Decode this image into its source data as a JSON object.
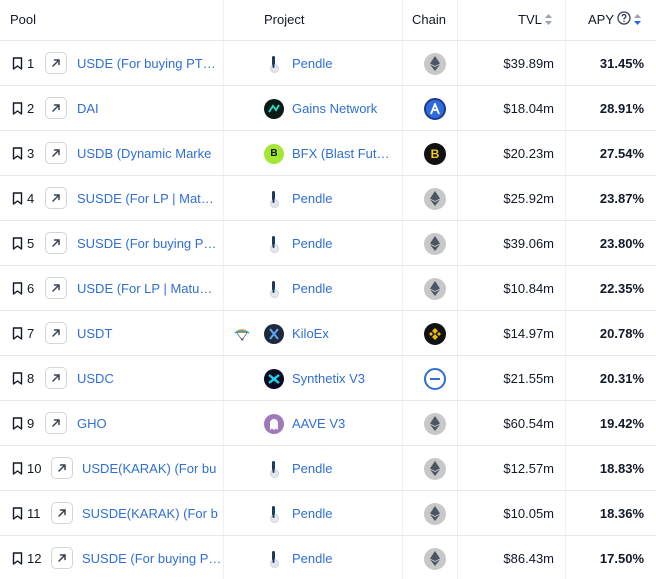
{
  "header": {
    "pool": "Pool",
    "project": "Project",
    "chain": "Chain",
    "tvl": "TVL",
    "apy": "APY"
  },
  "colors": {
    "link": "#2f6fd6",
    "sort_active": "#2563eb",
    "ethereum": "#c7c7c7",
    "arbitrum": "#2d6bdf",
    "blast": "#111111",
    "bsc": "#111111",
    "optimism_like": "#2f6fd6"
  },
  "rows": [
    {
      "rank": "1",
      "pool": "USDE (For buying PT…",
      "project": "Pendle",
      "project_icon": "pendle-icon",
      "chain_icon": "ethereum-icon",
      "tvl": "$39.89m",
      "apy": "31.45%"
    },
    {
      "rank": "2",
      "pool": "DAI",
      "project": "Gains Network",
      "project_icon": "gains-network-icon",
      "chain_icon": "arbitrum-icon",
      "tvl": "$18.04m",
      "apy": "28.91%"
    },
    {
      "rank": "3",
      "pool": "USDB (Dynamic Marke",
      "project": "BFX (Blast Fut…",
      "project_icon": "bfx-icon",
      "chain_icon": "blast-icon",
      "tvl": "$20.23m",
      "apy": "27.54%"
    },
    {
      "rank": "4",
      "pool": "SUSDE (For LP | Mat…",
      "project": "Pendle",
      "project_icon": "pendle-icon",
      "chain_icon": "ethereum-icon",
      "tvl": "$25.92m",
      "apy": "23.87%"
    },
    {
      "rank": "5",
      "pool": "SUSDE (For buying P…",
      "project": "Pendle",
      "project_icon": "pendle-icon",
      "chain_icon": "ethereum-icon",
      "tvl": "$39.06m",
      "apy": "23.80%"
    },
    {
      "rank": "6",
      "pool": "USDE (For LP | Matu…",
      "project": "Pendle",
      "project_icon": "pendle-icon",
      "chain_icon": "ethereum-icon",
      "tvl": "$10.84m",
      "apy": "22.35%"
    },
    {
      "rank": "7",
      "pool": "USDT",
      "project": "KiloEx",
      "project_icon": "kiloex-icon",
      "chain_icon": "bsc-icon",
      "tvl": "$14.97m",
      "apy": "20.78%",
      "extra_icon": "airdrop-icon"
    },
    {
      "rank": "8",
      "pool": "USDC",
      "project": "Synthetix V3",
      "project_icon": "synthetix-icon",
      "chain_icon": "base-icon",
      "tvl": "$21.55m",
      "apy": "20.31%"
    },
    {
      "rank": "9",
      "pool": "GHO",
      "project": "AAVE V3",
      "project_icon": "aave-icon",
      "chain_icon": "ethereum-icon",
      "tvl": "$60.54m",
      "apy": "19.42%"
    },
    {
      "rank": "10",
      "pool": "USDE(KARAK) (For bu",
      "project": "Pendle",
      "project_icon": "pendle-icon",
      "chain_icon": "ethereum-icon",
      "tvl": "$12.57m",
      "apy": "18.83%"
    },
    {
      "rank": "11",
      "pool": "SUSDE(KARAK) (For b",
      "project": "Pendle",
      "project_icon": "pendle-icon",
      "chain_icon": "ethereum-icon",
      "tvl": "$10.05m",
      "apy": "18.36%"
    },
    {
      "rank": "12",
      "pool": "SUSDE (For buying P…",
      "project": "Pendle",
      "project_icon": "pendle-icon",
      "chain_icon": "ethereum-icon",
      "tvl": "$86.43m",
      "apy": "17.50%"
    }
  ]
}
